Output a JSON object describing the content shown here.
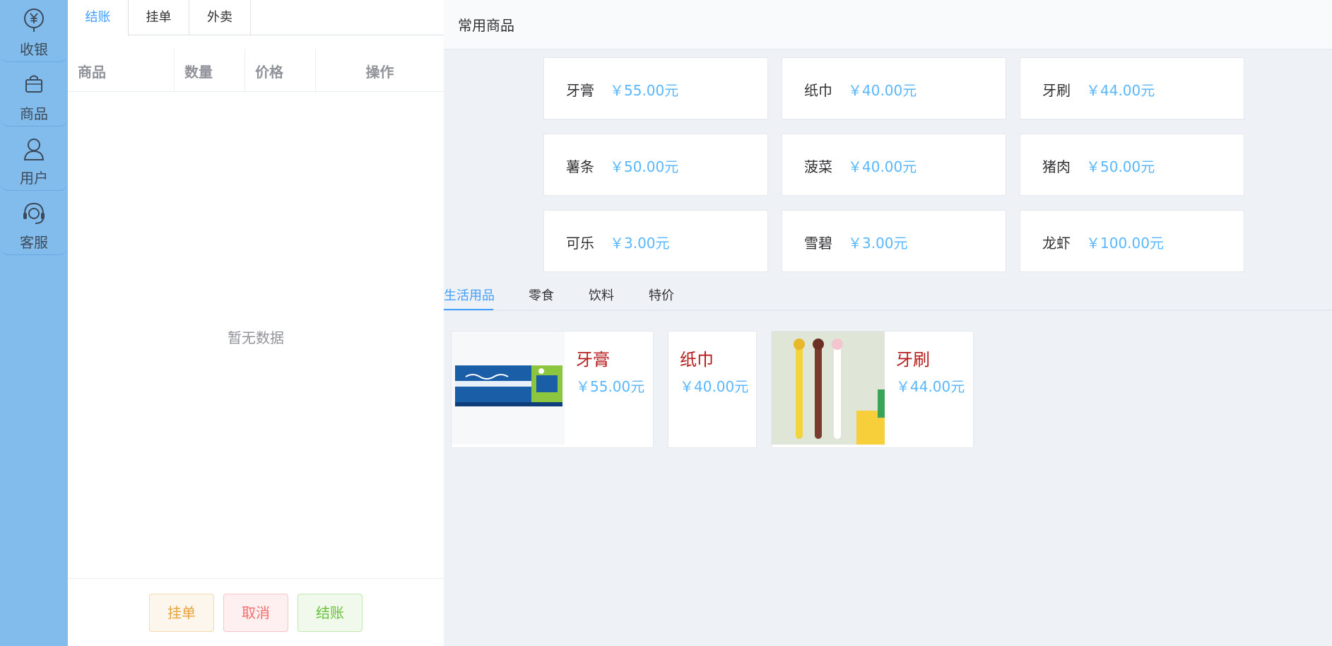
{
  "sidebar": {
    "items": [
      {
        "label": "收银",
        "icon": "cashier-yen-icon"
      },
      {
        "label": "商品",
        "icon": "shopping-bag-icon"
      },
      {
        "label": "用户",
        "icon": "user-icon"
      },
      {
        "label": "客服",
        "icon": "headset-icon"
      }
    ]
  },
  "order": {
    "tabs": [
      "结账",
      "挂单",
      "外卖"
    ],
    "active_tab": "结账",
    "columns": [
      "商品",
      "数量",
      "价格",
      "操作"
    ],
    "empty_text": "暂无数据",
    "buttons": {
      "hold": "挂单",
      "cancel": "取消",
      "checkout": "结账"
    }
  },
  "common": {
    "title": "常用商品",
    "items": [
      {
        "name": "牙膏",
        "price": "￥55.00元"
      },
      {
        "name": "纸巾",
        "price": "￥40.00元"
      },
      {
        "name": "牙刷",
        "price": "￥44.00元"
      },
      {
        "name": "薯条",
        "price": "￥50.00元"
      },
      {
        "name": "菠菜",
        "price": "￥40.00元"
      },
      {
        "name": "猪肉",
        "price": "￥50.00元"
      },
      {
        "name": "可乐",
        "price": "￥3.00元"
      },
      {
        "name": "雪碧",
        "price": "￥3.00元"
      },
      {
        "name": "龙虾",
        "price": "￥100.00元"
      }
    ]
  },
  "categories": {
    "tabs": [
      "生活用品",
      "零食",
      "饮料",
      "特价"
    ],
    "active": "生活用品"
  },
  "products": [
    {
      "name": "牙膏",
      "price": "￥55.00元",
      "image": "toothpaste-box-image"
    },
    {
      "name": "纸巾",
      "price": "￥40.00元",
      "image": null
    },
    {
      "name": "牙刷",
      "price": "￥44.00元",
      "image": "toothbrush-set-image"
    }
  ],
  "colors": {
    "sidebar": "#81bcec",
    "accent": "#409eff",
    "price": "#58b7ff",
    "product_name": "#b71c1c",
    "warning": "#e6a23c",
    "danger": "#f56c6c",
    "success": "#67c23a"
  }
}
